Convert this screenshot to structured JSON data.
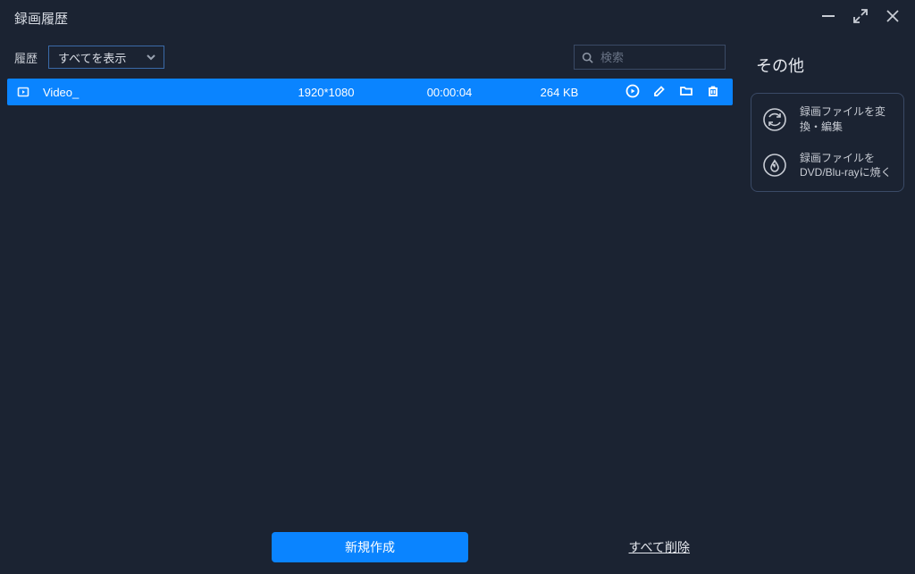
{
  "window": {
    "title": "録画履歴"
  },
  "toolbar": {
    "history_label": "履歴",
    "filter_selected": "すべてを表示",
    "search_placeholder": "検索"
  },
  "list": {
    "rows": [
      {
        "name": "Video_",
        "resolution": "1920*1080",
        "duration": "00:00:04",
        "size": "264 KB",
        "selected": true
      }
    ]
  },
  "footer": {
    "new_label": "新規作成",
    "delete_all_label": "すべて削除"
  },
  "sidepanel": {
    "title": "その他",
    "actions": [
      {
        "label": "録画ファイルを変換・編集",
        "icon": "convert-icon"
      },
      {
        "label": "録画ファイルをDVD/Blu-rayに焼く",
        "icon": "burn-icon"
      }
    ]
  },
  "colors": {
    "accent": "#0a84ff",
    "bg": "#1b2332",
    "border": "#3a4a66"
  }
}
